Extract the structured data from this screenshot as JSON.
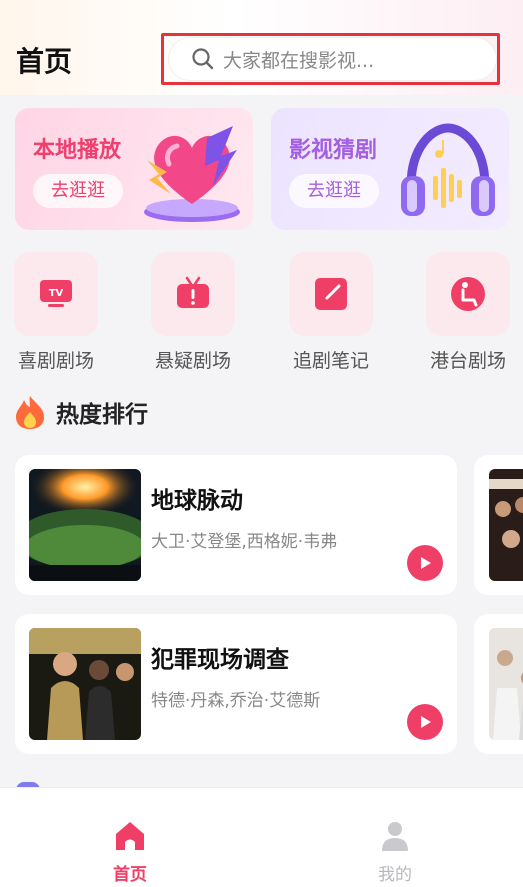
{
  "header": {
    "title": "首页",
    "search_placeholder": "大家都在搜影视..."
  },
  "features": [
    {
      "title": "本地播放",
      "button": "去逛逛"
    },
    {
      "title": "影视猜剧",
      "button": "去逛逛"
    }
  ],
  "categories": [
    {
      "label": "喜剧剧场",
      "icon": "tv-icon"
    },
    {
      "label": "悬疑剧场",
      "icon": "alert-tv-icon"
    },
    {
      "label": "追剧笔记",
      "icon": "note-icon"
    },
    {
      "label": "港台剧场",
      "icon": "seat-icon"
    }
  ],
  "section": {
    "title": "热度排行",
    "icon": "flame-icon"
  },
  "ranking": [
    {
      "title": "地球脉动",
      "cast": "大卫·艾登堡,西格妮·韦弗"
    },
    {
      "title": "犯罪现场调查",
      "cast": "特德·丹森,乔治·艾德斯"
    }
  ],
  "tabs": [
    {
      "label": "首页",
      "icon": "home-icon",
      "active": true
    },
    {
      "label": "我的",
      "icon": "user-icon",
      "active": false
    }
  ],
  "colors": {
    "accent": "#ef3f66",
    "highlight_border": "#e5323b"
  }
}
